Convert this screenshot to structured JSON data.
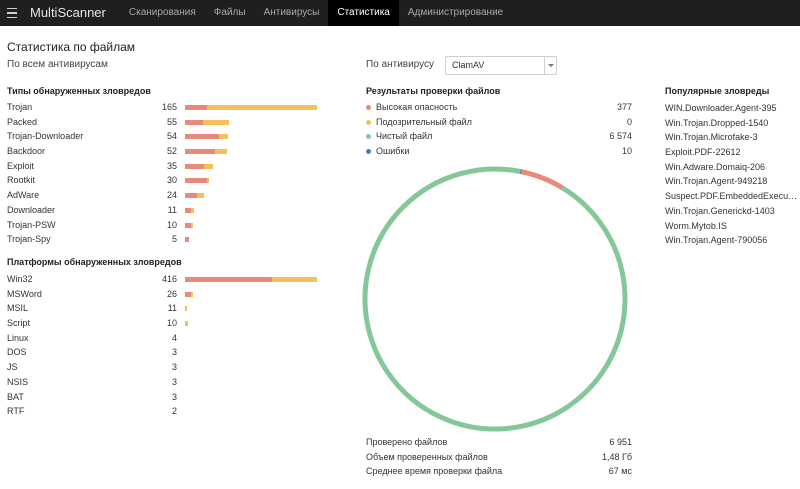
{
  "app": {
    "brand": "MultiScanner",
    "nav": [
      {
        "label": "Сканирования",
        "active": false
      },
      {
        "label": "Файлы",
        "active": false
      },
      {
        "label": "Антивирусы",
        "active": false
      },
      {
        "label": "Статистика",
        "active": true
      },
      {
        "label": "Администрирование",
        "active": false
      }
    ]
  },
  "page": {
    "title": "Статистика по файлам",
    "subtitle_all": "По всем антивирусам",
    "subtitle_av": "По антивирусу"
  },
  "av_select": {
    "value": "ClamAV"
  },
  "colors": {
    "high": "#e9897a",
    "suspicious": "#f3c05e",
    "clean": "#86c79a",
    "error": "#4a7cc6"
  },
  "types": {
    "title": "Типы обнаруженных зловредов",
    "bar_max": 165,
    "items": [
      {
        "name": "Trojan",
        "count": 165,
        "red": 27,
        "yellow": 138
      },
      {
        "name": "Packed",
        "count": 55,
        "red": 22,
        "yellow": 33
      },
      {
        "name": "Trojan-Downloader",
        "count": 54,
        "red": 43,
        "yellow": 11
      },
      {
        "name": "Backdoor",
        "count": 52,
        "red": 37,
        "yellow": 15
      },
      {
        "name": "Exploit",
        "count": 35,
        "red": 24,
        "yellow": 11
      },
      {
        "name": "Rootkit",
        "count": 30,
        "red": 28,
        "yellow": 2
      },
      {
        "name": "AdWare",
        "count": 24,
        "red": 15,
        "yellow": 9
      },
      {
        "name": "Downloader",
        "count": 11,
        "red": 8,
        "yellow": 3
      },
      {
        "name": "Trojan-PSW",
        "count": 10,
        "red": 8,
        "yellow": 2
      },
      {
        "name": "Trojan-Spy",
        "count": 5,
        "red": 5,
        "yellow": 0
      }
    ]
  },
  "platforms": {
    "title": "Платформы обнаруженных зловредов",
    "bar_max": 416,
    "items": [
      {
        "name": "Win32",
        "count": 416,
        "red": 275,
        "yellow": 141
      },
      {
        "name": "MSWord",
        "count": 26,
        "red": 20,
        "yellow": 6
      },
      {
        "name": "MSIL",
        "count": 11,
        "red": 0,
        "yellow": 3
      },
      {
        "name": "Script",
        "count": 10,
        "red": 0,
        "yellow": 8
      },
      {
        "name": "Linux",
        "count": 4,
        "red": 0,
        "yellow": 0
      },
      {
        "name": "DOS",
        "count": 3,
        "red": 0,
        "yellow": 0
      },
      {
        "name": "JS",
        "count": 3,
        "red": 0,
        "yellow": 0
      },
      {
        "name": "NSIS",
        "count": 3,
        "red": 0,
        "yellow": 0
      },
      {
        "name": "BAT",
        "count": 3,
        "red": 0,
        "yellow": 0
      },
      {
        "name": "RTF",
        "count": 2,
        "red": 0,
        "yellow": 0
      }
    ]
  },
  "results": {
    "title": "Результаты проверки файлов",
    "items": [
      {
        "key": "high",
        "label": "Высокая опасность",
        "value": "377",
        "num": 377
      },
      {
        "key": "suspicious",
        "label": "Подозрительный файл",
        "value": "0",
        "num": 0
      },
      {
        "key": "clean",
        "label": "Чистый файл",
        "value": "6 574",
        "num": 6574
      },
      {
        "key": "error",
        "label": "Ошибки",
        "value": "10",
        "num": 10
      }
    ]
  },
  "summary": [
    {
      "label": "Проверено файлов",
      "value": "6 951"
    },
    {
      "label": "Объем проверенных файлов",
      "value": "1,48 Гб"
    },
    {
      "label": "Среднее время проверки файла",
      "value": "67 мс"
    }
  ],
  "popular": {
    "title": "Популярные зловреды",
    "items": [
      "WIN.Downloader.Agent-395",
      "Win.Trojan.Dropped-1540",
      "Win.Trojan.Microfake-3",
      "Exploit.PDF-22612",
      "Win.Adware.Domaiq-206",
      "Win.Trojan.Agent-949218",
      "Suspect.PDF.EmbeddedExecutable",
      "Win.Trojan.Generickd-1403",
      "Worm.Mytob.IS",
      "Win.Trojan.Agent-790056"
    ]
  }
}
